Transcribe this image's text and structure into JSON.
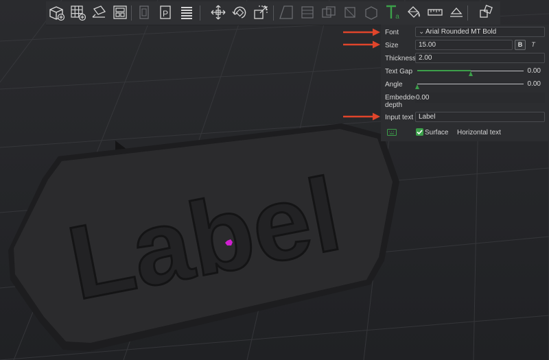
{
  "toolbar": {
    "tools": [
      "add-cube-icon",
      "grid-add-icon",
      "auto-orient-icon",
      "arrange-icon",
      "split-objects-icon",
      "split-parts-icon",
      "variable-layer-icon",
      "move-icon",
      "rotate-icon",
      "scale-icon",
      "cut-icon",
      "hollow-icon",
      "boolean-icon",
      "place-on-face-icon",
      "support-paint-icon",
      "text-tool-icon",
      "color-paint-icon",
      "measure-icon",
      "assembly-icon",
      "explode-icon"
    ]
  },
  "panel": {
    "font": {
      "label": "Font",
      "value": "Arial Rounded MT Bold"
    },
    "size": {
      "label": "Size",
      "value": "15.00",
      "bold_label": "B",
      "italic_label": "T"
    },
    "thickness": {
      "label": "Thickness",
      "value": "2.00"
    },
    "text_gap": {
      "label": "Text Gap",
      "value": "0.00",
      "level": 0.5
    },
    "angle": {
      "label": "Angle",
      "value": "0.00",
      "level": 0.0
    },
    "embedded_depth": {
      "label_line1": "Embedded",
      "label_line2": "depth",
      "value": "0.00"
    },
    "input_text": {
      "label": "Input text",
      "value": "Label"
    },
    "surface": {
      "label": "Surface",
      "checked": true
    },
    "horizontal_text": {
      "label": "Horizontal text"
    }
  },
  "model": {
    "text": "Label"
  },
  "colors": {
    "accent": "#3ca04a",
    "annotation_arrow": "#e0452b",
    "gizmo": "#d01fd1"
  }
}
